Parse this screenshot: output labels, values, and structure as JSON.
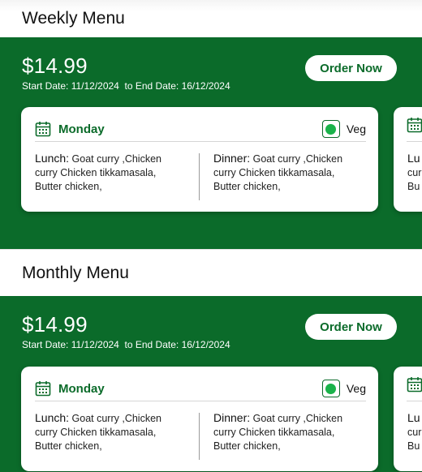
{
  "weekly": {
    "title": "Weekly Menu",
    "price": "$14.99",
    "date_range": "Start Date: 11/12/2024  to End Date: 16/12/2024",
    "order_label": "Order Now",
    "card": {
      "day": "Monday",
      "veg_label": "Veg",
      "lunch_label": "Lunch:",
      "lunch_items": " Goat curry ,Chicken curry Chicken tikkamasala, Butter chicken,",
      "dinner_label": "Dinner:",
      "dinner_items": " Goat curry ,Chicken curry Chicken tikkamasala, Butter chicken,"
    },
    "peek": {
      "l1": "Lu",
      "l2": "cur",
      "l3": "Bu"
    }
  },
  "monthly": {
    "title": "Monthly Menu",
    "price": "$14.99",
    "date_range": "Start Date: 11/12/2024  to End Date: 16/12/2024",
    "order_label": "Order Now",
    "card": {
      "day": "Monday",
      "veg_label": "Veg",
      "lunch_label": "Lunch:",
      "lunch_items": " Goat curry ,Chicken curry Chicken tikkamasala, Butter chicken,",
      "dinner_label": "Dinner:",
      "dinner_items": " Goat curry ,Chicken curry Chicken tikkamasala, Butter chicken,"
    },
    "peek": {
      "l1": "Lu",
      "l2": "cur",
      "l3": "Bu"
    }
  },
  "colors": {
    "brand_green": "#0b6b2a",
    "veg_dot": "#19b34a"
  },
  "icons": {
    "calendar": "calendar-icon",
    "veg": "veg-indicator-icon"
  }
}
